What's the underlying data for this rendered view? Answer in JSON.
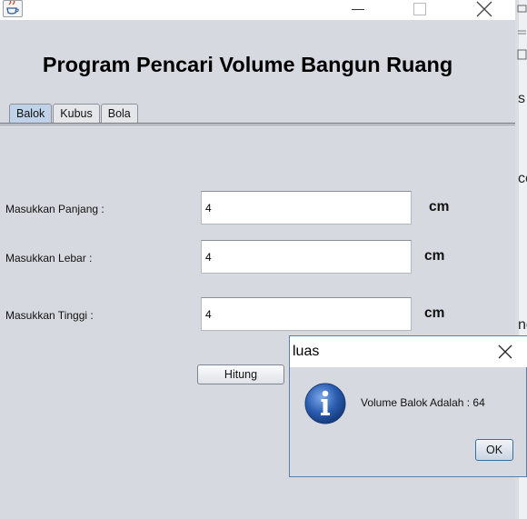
{
  "window": {
    "icon": "java-cup-icon",
    "controls": {
      "minimize": "minimize-icon",
      "maximize": "maximize-icon",
      "close": "close-icon"
    }
  },
  "main": {
    "title": "Program Pencari Volume Bangun Ruang",
    "tabs": [
      {
        "label": "Balok",
        "active": true
      },
      {
        "label": "Kubus",
        "active": false
      },
      {
        "label": "Bola",
        "active": false
      }
    ],
    "rows": [
      {
        "label": "Masukkan Panjang :",
        "value": "4",
        "unit": "cm"
      },
      {
        "label": "Masukkan Lebar :",
        "value": "4",
        "unit": "cm"
      },
      {
        "label": "Masukkan Tinggi :",
        "value": "4",
        "unit": "cm"
      }
    ],
    "hitung_label": "Hitung"
  },
  "background_window": {
    "fragments": [
      "s",
      "ce",
      "ne"
    ]
  },
  "dialog": {
    "title": "luas",
    "icon": "info-icon",
    "message": "Volume Balok Adalah : 64",
    "ok_label": "OK"
  },
  "colors": {
    "panel_bg": "#d6d9df",
    "tab_active": "#bfd2e7",
    "dialog_border": "#5b7fa8",
    "info_icon": "#2a5db0"
  }
}
